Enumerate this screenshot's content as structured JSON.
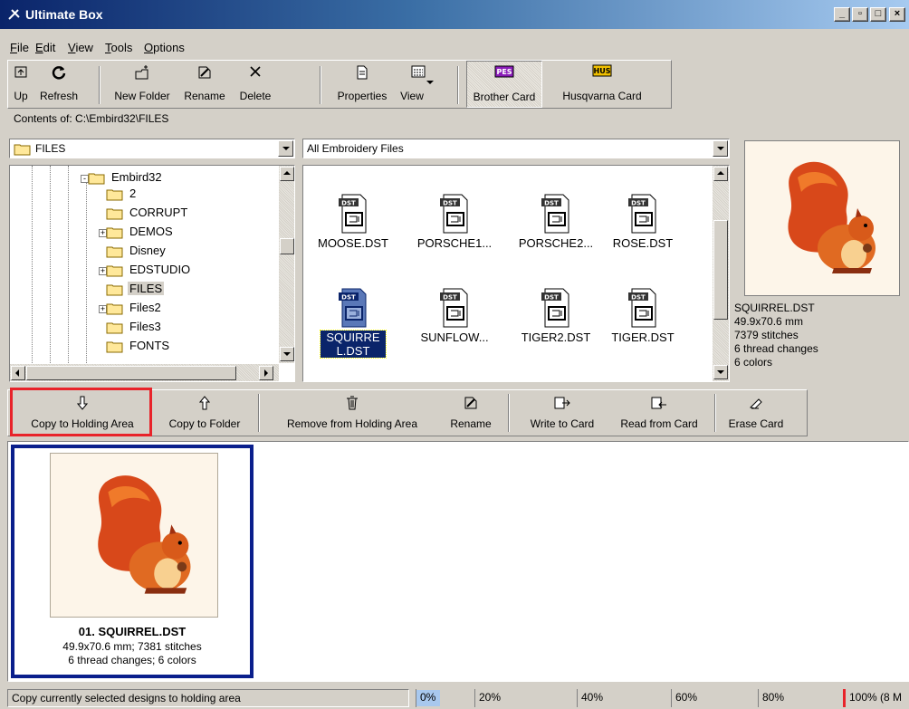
{
  "window": {
    "title": "Ultimate Box"
  },
  "menu": [
    "File",
    "Edit",
    "View",
    "Tools",
    "Options"
  ],
  "toolbar": {
    "up": "Up",
    "refresh": "Refresh",
    "new_folder": "New Folder",
    "rename": "Rename",
    "delete": "Delete",
    "properties": "Properties",
    "view": "View",
    "brother_card": "Brother Card",
    "husqvarna_card": "Husqvarna Card",
    "pes_badge": "PES",
    "hus_badge": "HUS"
  },
  "contents_label": "Contents of: C:\\Embird32\\FILES",
  "folder_combo": "FILES",
  "filter_combo": "All Embroidery Files",
  "tree": [
    {
      "label": "Embird32",
      "expander": "-"
    },
    {
      "label": "2",
      "expander": ""
    },
    {
      "label": "CORRUPT",
      "expander": ""
    },
    {
      "label": "DEMOS",
      "expander": "+"
    },
    {
      "label": "Disney",
      "expander": ""
    },
    {
      "label": "EDSTUDIO",
      "expander": "+"
    },
    {
      "label": "FILES",
      "expander": ""
    },
    {
      "label": "Files2",
      "expander": "+"
    },
    {
      "label": "Files3",
      "expander": ""
    },
    {
      "label": "FONTS",
      "expander": ""
    }
  ],
  "files": [
    {
      "name": "MOOSE.DST",
      "badge": "DST"
    },
    {
      "name": "PORSCHE1...",
      "badge": "DST"
    },
    {
      "name": "PORSCHE2...",
      "badge": "DST"
    },
    {
      "name": "ROSE.DST",
      "badge": "DST"
    },
    {
      "name": "SQUIRREL.DST",
      "badge": "DST",
      "selected": true
    },
    {
      "name": "SUNFLOW...",
      "badge": "DST"
    },
    {
      "name": "TIGER2.DST",
      "badge": "DST"
    },
    {
      "name": "TIGER.DST",
      "badge": "DST"
    }
  ],
  "preview": {
    "name": "SQUIRREL.DST",
    "size": "49.9x70.6 mm",
    "stitches": "7379 stitches",
    "thread_changes": "6 thread changes",
    "colors": "6 colors"
  },
  "holding_toolbar": {
    "copy_to_holding": "Copy to Holding Area",
    "copy_to_folder": "Copy to Folder",
    "remove": "Remove from Holding Area",
    "rename": "Rename",
    "write_card": "Write to Card",
    "read_card": "Read from Card",
    "erase_card": "Erase Card"
  },
  "holding_item": {
    "title": "01. SQUIRREL.DST",
    "line1": "49.9x70.6 mm; 7381 stitches",
    "line2": "6 thread changes; 6 colors"
  },
  "status": {
    "text": "Copy currently selected designs to holding area",
    "progress": [
      "0%",
      "20%",
      "40%",
      "60%",
      "80%",
      "100% (8 M"
    ],
    "progress_fraction": 0.05
  },
  "colors": {
    "highlight": "#e8232a",
    "selection": "#0a246a",
    "card_border": "#0a1f8c"
  }
}
